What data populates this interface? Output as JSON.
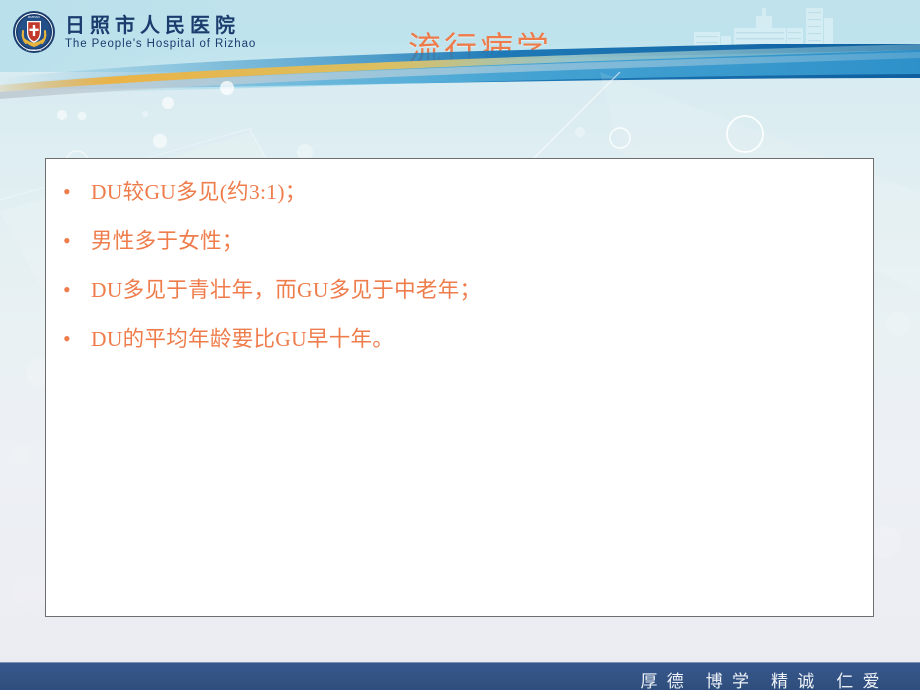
{
  "slide": {
    "title": "流行病学"
  },
  "header": {
    "logo": {
      "icon_name": "hospital-emblem-icon",
      "name_cn": "日照市人民医院",
      "name_en": "The People's Hospital of Rizhao"
    },
    "skyline_icon": "hospital-building-skyline-icon"
  },
  "content": {
    "bullet_marker": "•",
    "items": [
      {
        "text": "DU较GU多见(约3:1)；"
      },
      {
        "text": "男性多于女性；"
      },
      {
        "text": "DU多见于青壮年，而GU多见于中老年；"
      },
      {
        "text": "DU的平均年龄要比GU早十年。"
      }
    ]
  },
  "footer": {
    "motto": "厚 德　博 学　精 诚　仁 爱"
  },
  "colors": {
    "accent_orange": "#ef7c4b",
    "header_cyan": "#bfe2ec",
    "footer_navy": "#325283",
    "logo_navy": "#1b3d6e",
    "box_border": "#6e6e6e"
  }
}
